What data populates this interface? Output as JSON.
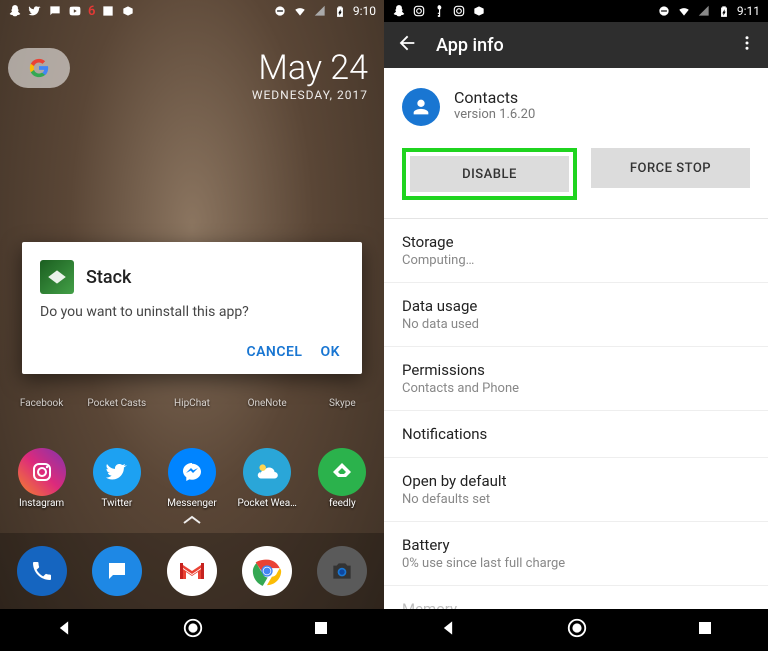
{
  "left": {
    "status": {
      "icons_left": [
        "ghost",
        "camera-o",
        "chat",
        "youtube",
        "count",
        "image",
        "box"
      ],
      "notif_count": "6",
      "time": "9:10"
    },
    "date": {
      "main": "May 24",
      "sub": "WEDNESDAY, 2017"
    },
    "row_top": [
      {
        "label": "Facebook"
      },
      {
        "label": "Pocket Casts"
      },
      {
        "label": "HipChat"
      },
      {
        "label": "OneNote"
      },
      {
        "label": "Skype"
      }
    ],
    "row_apps": [
      {
        "label": "Instagram",
        "bg": "#d63a7b"
      },
      {
        "label": "Twitter",
        "bg": "#1da1f2"
      },
      {
        "label": "Messenger",
        "bg": "#0084ff"
      },
      {
        "label": "Pocket Wea…",
        "bg": "#2aa6d8"
      },
      {
        "label": "feedly",
        "bg": "#2bb24c"
      }
    ],
    "dock": [
      {
        "name": "phone-icon",
        "bg": "#1565c0"
      },
      {
        "name": "messages-icon",
        "bg": "#1e88e5"
      },
      {
        "name": "gmail-icon",
        "bg": "#fff"
      },
      {
        "name": "chrome-icon",
        "bg": "#fff"
      },
      {
        "name": "camera-icon",
        "bg": "#424242"
      }
    ],
    "dialog": {
      "title": "Stack",
      "message": "Do you want to uninstall this app?",
      "cancel": "CANCEL",
      "ok": "OK"
    }
  },
  "right": {
    "status": {
      "time": "9:11"
    },
    "appbar": {
      "title": "App info"
    },
    "header": {
      "name": "Contacts",
      "version": "version 1.6.20"
    },
    "buttons": {
      "disable": "DISABLE",
      "force_stop": "FORCE STOP"
    },
    "items": [
      {
        "title": "Storage",
        "sub": "Computing…"
      },
      {
        "title": "Data usage",
        "sub": "No data used"
      },
      {
        "title": "Permissions",
        "sub": "Contacts and Phone"
      },
      {
        "title": "Notifications",
        "sub": ""
      },
      {
        "title": "Open by default",
        "sub": "No defaults set"
      },
      {
        "title": "Battery",
        "sub": "0% use since last full charge"
      },
      {
        "title": "Memory",
        "sub": "",
        "muted": true
      }
    ]
  }
}
